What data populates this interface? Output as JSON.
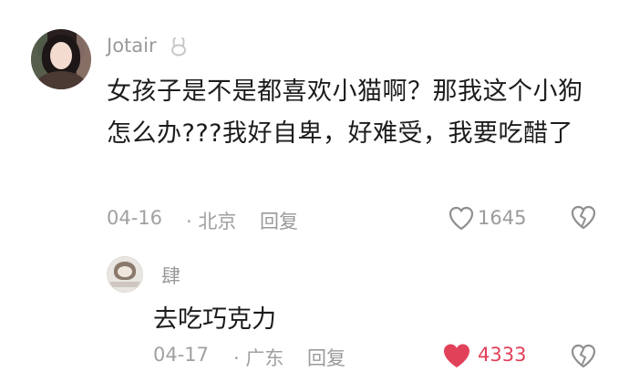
{
  "colors": {
    "text_primary": "#1c1c1c",
    "text_meta": "#a0a0a0",
    "like_active": "#e2415a"
  },
  "comment": {
    "username": "Jotair",
    "badge_icon": "rabbit-icon",
    "text": "女孩子是不是都喜欢小猫啊？那我这个小狗怎么办???我好自卑，好难受，我要吃醋了",
    "date": "04-16",
    "location": "· 北京",
    "reply_label": "回复",
    "like_count": "1645",
    "like_icon": "heart-outline-icon",
    "dislike_icon": "broken-heart-icon"
  },
  "reply": {
    "username": "肆",
    "text": "去吃巧克力",
    "date": "04-17",
    "location": "· 广东",
    "reply_label": "回复",
    "like_count": "4333",
    "like_icon": "heart-filled-icon",
    "dislike_icon": "broken-heart-icon"
  }
}
